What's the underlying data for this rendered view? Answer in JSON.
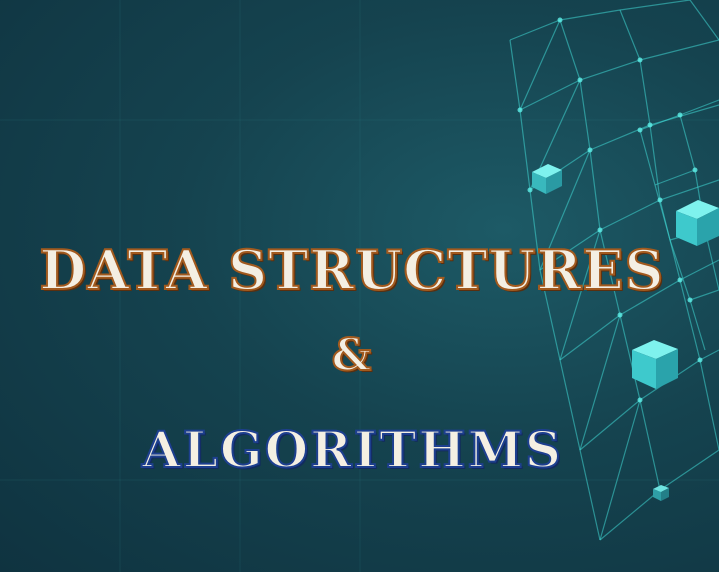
{
  "title": {
    "line1": "DATA STRUCTURES",
    "ampersand": "&",
    "line2": "ALGORITHMS"
  },
  "colors": {
    "background": "#15434f",
    "mesh": "#3fd6d2",
    "cube": "#48e0df",
    "text_fill": "#f4efe3",
    "outline_top": "#a25a1e",
    "outline_bottom": "#1d3f8f"
  }
}
